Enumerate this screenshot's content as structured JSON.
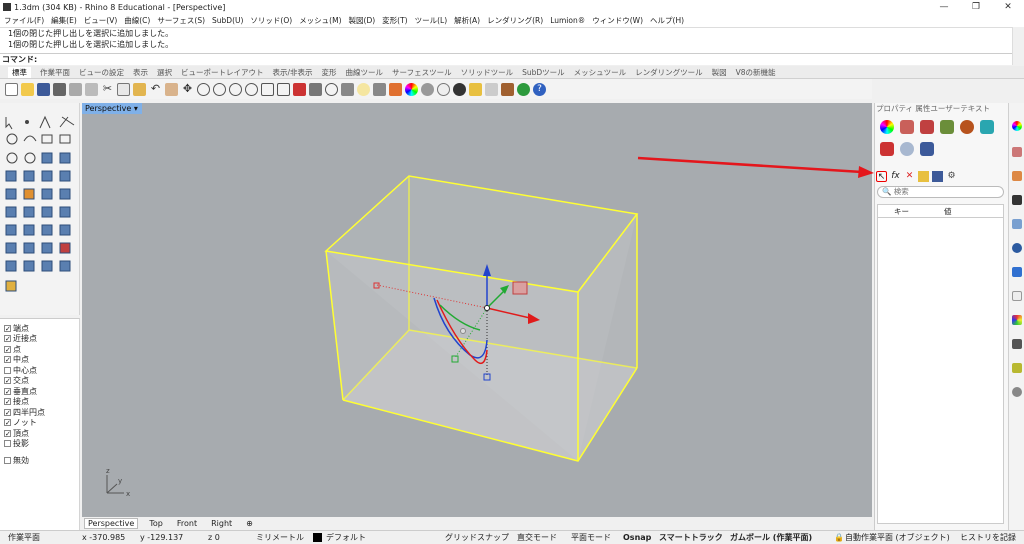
{
  "window": {
    "title": "1.3dm (304 KB) - Rhino 8 Educational - [Perspective]",
    "minimize": "—",
    "maximize": "❐",
    "close": "✕"
  },
  "menu": [
    "ファイル(F)",
    "編集(E)",
    "ビュー(V)",
    "曲線(C)",
    "サーフェス(S)",
    "SubD(U)",
    "ソリッド(O)",
    "メッシュ(M)",
    "製図(D)",
    "変形(T)",
    "ツール(L)",
    "解析(A)",
    "レンダリング(R)",
    "Lumion®",
    "ウィンドウ(W)",
    "ヘルプ(H)"
  ],
  "command_history": [
    "1個の閉じた押し出しを選択に追加しました。",
    "1個の閉じた押し出しを選択に追加しました。"
  ],
  "command_prompt": "コマンド:",
  "toolbar_tabs": [
    "標準",
    "作業平面",
    "ビューの設定",
    "表示",
    "選択",
    "ビューポートレイアウト",
    "表示/非表示",
    "変形",
    "曲線ツール",
    "サーフェスツール",
    "ソリッドツール",
    "SubDツール",
    "メッシュツール",
    "レンダリングツール",
    "製図",
    "V8の新機能"
  ],
  "viewport": {
    "title": "Perspective",
    "tabs": [
      "Perspective",
      "Top",
      "Front",
      "Right"
    ],
    "add_tab": "⊕",
    "axis_x": "x",
    "axis_y": "y",
    "axis_z": "z"
  },
  "osnap": [
    {
      "label": "端点",
      "checked": true
    },
    {
      "label": "近接点",
      "checked": true
    },
    {
      "label": "点",
      "checked": true
    },
    {
      "label": "中点",
      "checked": true
    },
    {
      "label": "中心点",
      "checked": false
    },
    {
      "label": "交点",
      "checked": true
    },
    {
      "label": "垂直点",
      "checked": true
    },
    {
      "label": "接点",
      "checked": true
    },
    {
      "label": "四半円点",
      "checked": true
    },
    {
      "label": "ノット",
      "checked": true
    },
    {
      "label": "頂点",
      "checked": true
    },
    {
      "label": "投影",
      "checked": false
    },
    {
      "label": "無効",
      "checked": false
    }
  ],
  "panel": {
    "tabs": "プロパティ 属性ユーザーテキスト",
    "search_placeholder": "検索",
    "col_key": "キー",
    "col_value": "値",
    "search_icon": "🔍",
    "fx": "fx",
    "delete": "✕"
  },
  "status": {
    "plane": "作業平面",
    "x": "x -370.985",
    "y": "y -129.137",
    "z": "z 0",
    "units": "ミリメートル",
    "layer": "デフォルト",
    "grid_snap": "グリッドスナップ",
    "ortho": "直交モード",
    "planar": "平面モード",
    "osnap": "Osnap",
    "smarttrack": "スマートトラック",
    "gumball": "ガムボール (作業平面)",
    "auto_cplane": "自動作業平面 (オブジェクト)",
    "history": "ヒストリを記録"
  },
  "colors": {
    "selection": "#ffff33",
    "arrow": "#e4161c",
    "viewport_bg": "#a7abaf",
    "viewport_title": "#7fb0e8"
  }
}
